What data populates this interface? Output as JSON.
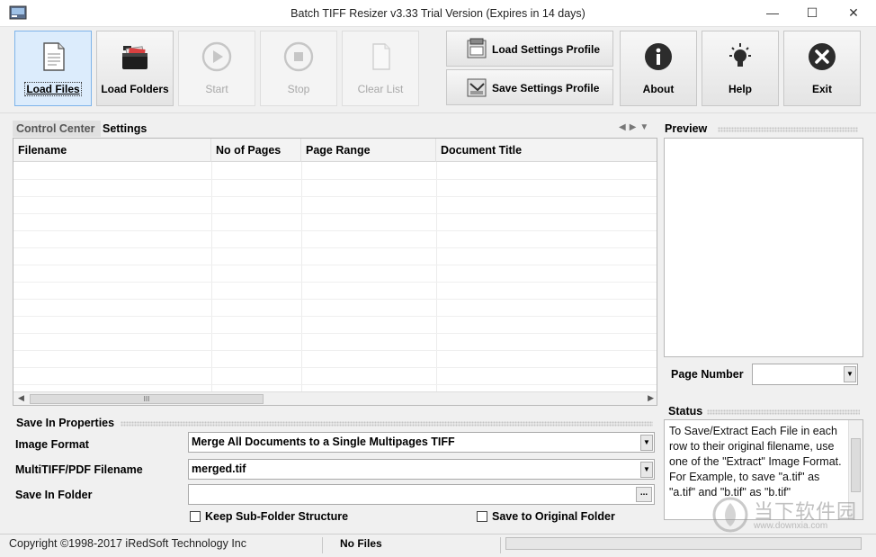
{
  "window": {
    "title": "Batch TIFF Resizer v3.33   Trial Version (Expires in 14 days)"
  },
  "toolbar": {
    "load_files": "Load Files",
    "load_folders": "Load Folders",
    "start": "Start",
    "stop": "Stop",
    "clear_list": "Clear List",
    "load_settings_profile": "Load Settings Profile",
    "save_settings_profile": "Save Settings Profile",
    "about": "About",
    "help": "Help",
    "exit": "Exit"
  },
  "tabs": {
    "control_center": "Control Center",
    "settings": "Settings"
  },
  "grid": {
    "columns": [
      "Filename",
      "No of Pages",
      "Page Range",
      "Document Title"
    ],
    "scroll_grip": "III"
  },
  "preview": {
    "title": "Preview",
    "page_number_label": "Page Number"
  },
  "status": {
    "title": "Status",
    "text": "To Save/Extract Each File in each row to their original filename, use one of the \"Extract\" Image Format. For Example, to save \"a.tif\" as \"a.tif\" and \"b.tif\" as \"b.tif\""
  },
  "properties": {
    "title": "Save In Properties",
    "image_format_label": "Image Format",
    "image_format_value": "Merge All Documents to a Single Multipages TIFF",
    "multitiff_label": "MultiTIFF/PDF Filename",
    "multitiff_value": "merged.tif",
    "save_folder_label": "Save In Folder",
    "save_folder_value": "",
    "browse_label": "...",
    "keep_subfolder_label": "Keep Sub-Folder Structure",
    "keep_subfolder_checked": false,
    "save_original_label": "Save to Original Folder",
    "save_original_checked": false
  },
  "statusbar": {
    "copyright": "Copyright ©1998-2017 iRedSoft Technology Inc",
    "files": "No Files"
  },
  "watermark": {
    "text": "当下软件园",
    "url": "www.downxia.com"
  }
}
